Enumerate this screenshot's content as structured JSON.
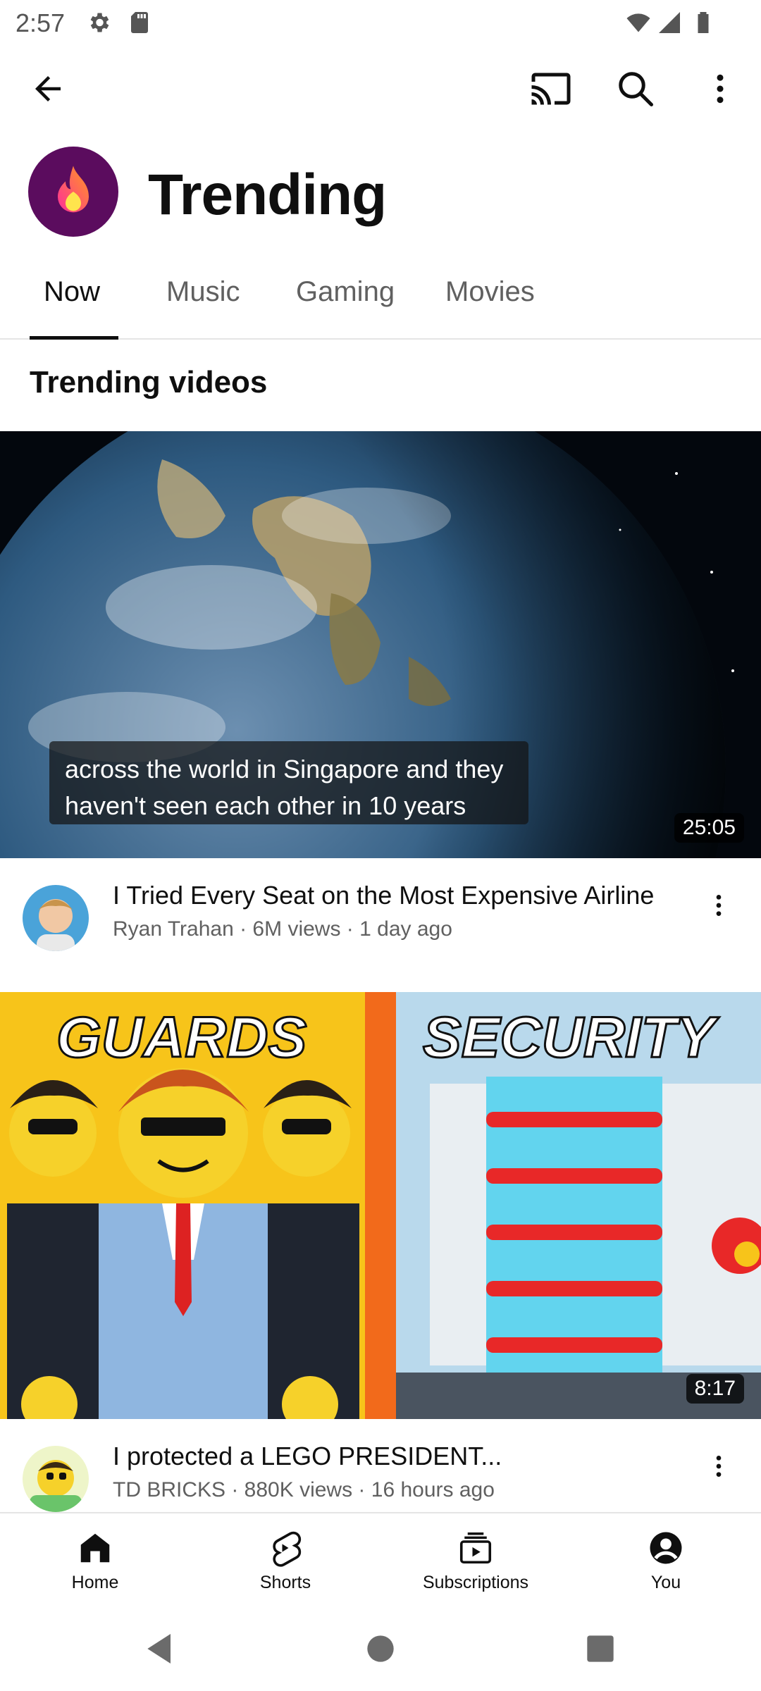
{
  "status": {
    "time": "2:57",
    "icons": [
      "gear-icon",
      "sd-card-icon",
      "wifi-icon",
      "signal-icon",
      "battery-icon"
    ]
  },
  "toolbar": {
    "icons": [
      "back-arrow-icon",
      "cast-icon",
      "search-icon",
      "more-vertical-icon"
    ]
  },
  "header": {
    "title": "Trending",
    "avatar_icon": "flame-icon",
    "avatar_color": "#5b0c5e"
  },
  "tabs": [
    {
      "label": "Now",
      "active": true
    },
    {
      "label": "Music",
      "active": false
    },
    {
      "label": "Gaming",
      "active": false
    },
    {
      "label": "Movies",
      "active": false
    }
  ],
  "section": {
    "title": "Trending videos"
  },
  "videos": [
    {
      "caption_line1": "across the world in Singapore and they",
      "caption_line2": "haven't seen each other in 10 years",
      "duration": "25:05",
      "title": "I Tried Every Seat on the Most Expensive Airline",
      "meta": "Ryan Trahan · 6M views · 1 day ago"
    },
    {
      "thumb_text_left": "GUARDS",
      "thumb_text_right": "SECURITY",
      "duration": "8:17",
      "title": "I protected a LEGO PRESIDENT...",
      "meta": "TD BRICKS · 880K views · 16 hours ago"
    }
  ],
  "nav": [
    {
      "label": "Home",
      "icon": "home-icon"
    },
    {
      "label": "Shorts",
      "icon": "shorts-icon"
    },
    {
      "label": "Subscriptions",
      "icon": "subscriptions-icon"
    },
    {
      "label": "You",
      "icon": "account-icon"
    }
  ],
  "colors": {
    "text_primary": "#0f0f0f",
    "text_secondary": "#606060",
    "divider": "#e5e5e5"
  }
}
